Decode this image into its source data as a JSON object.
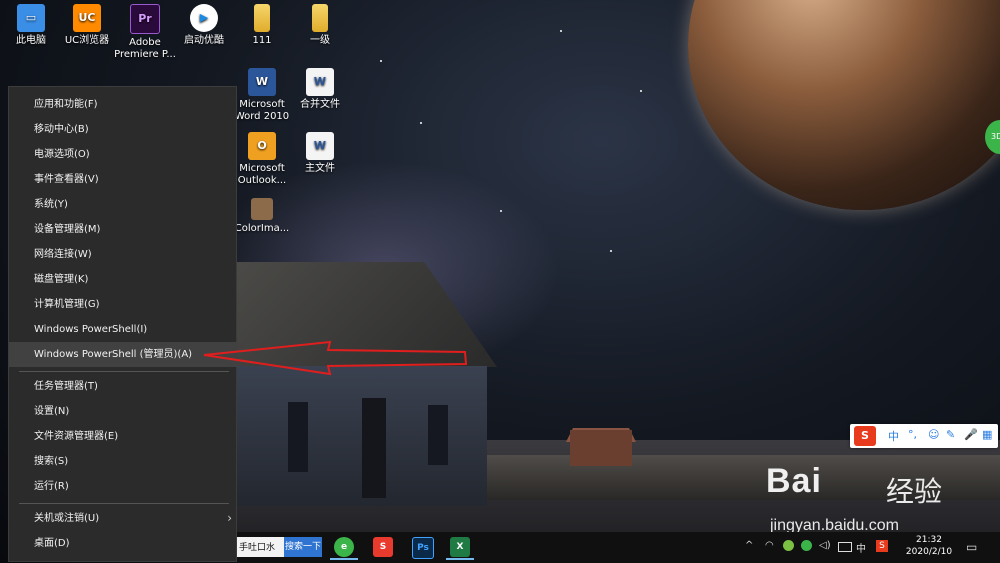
{
  "desktop": {
    "icons": [
      {
        "label": "此电脑",
        "glyph": "▭"
      },
      {
        "label": "UC浏览器",
        "glyph": "UC"
      },
      {
        "label": "Adobe Premiere P...",
        "glyph": "Pr"
      },
      {
        "label": "启动优酷",
        "glyph": "▶"
      },
      {
        "label": "111",
        "glyph": ""
      },
      {
        "label": "一级",
        "glyph": ""
      },
      {
        "label": "Microsoft Word 2010",
        "glyph": "W"
      },
      {
        "label": "合并文件",
        "glyph": "W"
      },
      {
        "label": "Microsoft Outlook...",
        "glyph": "O"
      },
      {
        "label": "主文件",
        "glyph": "W"
      },
      {
        "label": "ColorIma...",
        "glyph": ""
      }
    ]
  },
  "context_menu": {
    "group1": [
      "应用和功能(F)",
      "移动中心(B)",
      "电源选项(O)",
      "事件查看器(V)",
      "系统(Y)",
      "设备管理器(M)",
      "网络连接(W)",
      "磁盘管理(K)",
      "计算机管理(G)",
      "Windows PowerShell(I)",
      "Windows PowerShell (管理员)(A)"
    ],
    "group2": [
      "任务管理器(T)",
      "设置(N)",
      "文件资源管理器(E)",
      "搜索(S)",
      "运行(R)"
    ],
    "group3": [
      "关机或注销(U)",
      "桌面(D)"
    ],
    "highlighted": "Windows PowerShell (管理员)(A)",
    "submenu_chevron": "›"
  },
  "taskbar": {
    "search_value": "手吐口水",
    "search_button": "搜索一下",
    "apps": [
      {
        "name": "360-browser-icon",
        "glyph": "e",
        "color": "#3bb54a"
      },
      {
        "name": "wps-icon",
        "glyph": "S",
        "color": "#e83a2d"
      },
      {
        "name": "photoshop-icon",
        "glyph": "Ps",
        "color": "#0b2a4a"
      },
      {
        "name": "excel-icon",
        "glyph": "X",
        "color": "#1f7a43"
      }
    ],
    "tray": {
      "chevron": "^",
      "ime": "中",
      "sogou": "S"
    },
    "clock": {
      "time": "21:32",
      "date": "2020/2/10"
    },
    "notification_glyph": "▭"
  },
  "ime_bar": {
    "logo": "S",
    "mode": "中",
    "punct": "°,",
    "icons": [
      "☺",
      "✎",
      "🎤",
      "▦"
    ]
  },
  "watermark": {
    "brand": "Bai",
    "brand_cn": "经验",
    "url": "jingyan.baidu.com"
  },
  "badge": "3D",
  "colors": {
    "menu_bg": "#2b2b2b",
    "menu_hl": "#414141",
    "arrow": "#e01e1e",
    "taskbar": "#101010"
  }
}
